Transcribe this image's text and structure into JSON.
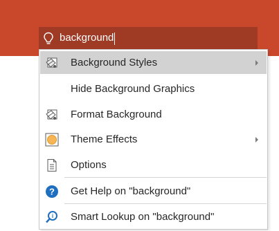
{
  "colors": {
    "ribbon": "#c9472a",
    "search_box": "#9f3a25",
    "menu_highlight": "#d2d2d2",
    "help_icon": "#1e6fbf"
  },
  "search": {
    "value": "background",
    "icon": "lightbulb-icon"
  },
  "menu": {
    "items": [
      {
        "label": "Background Styles",
        "icon": "background-styles-icon",
        "has_submenu": true,
        "highlighted": true
      },
      {
        "label": "Hide Background Graphics",
        "icon": "",
        "has_submenu": false
      },
      {
        "label": "Format Background",
        "icon": "format-background-icon",
        "has_submenu": false
      },
      {
        "label": "Theme Effects",
        "icon": "theme-effects-icon",
        "has_submenu": true
      },
      {
        "label": "Options",
        "icon": "options-icon",
        "has_submenu": false
      },
      {
        "label": "Get Help on \"background\"",
        "icon": "help-icon",
        "has_submenu": false
      },
      {
        "label": "Smart Lookup on \"background\"",
        "icon": "smart-lookup-icon",
        "has_submenu": false
      }
    ]
  }
}
